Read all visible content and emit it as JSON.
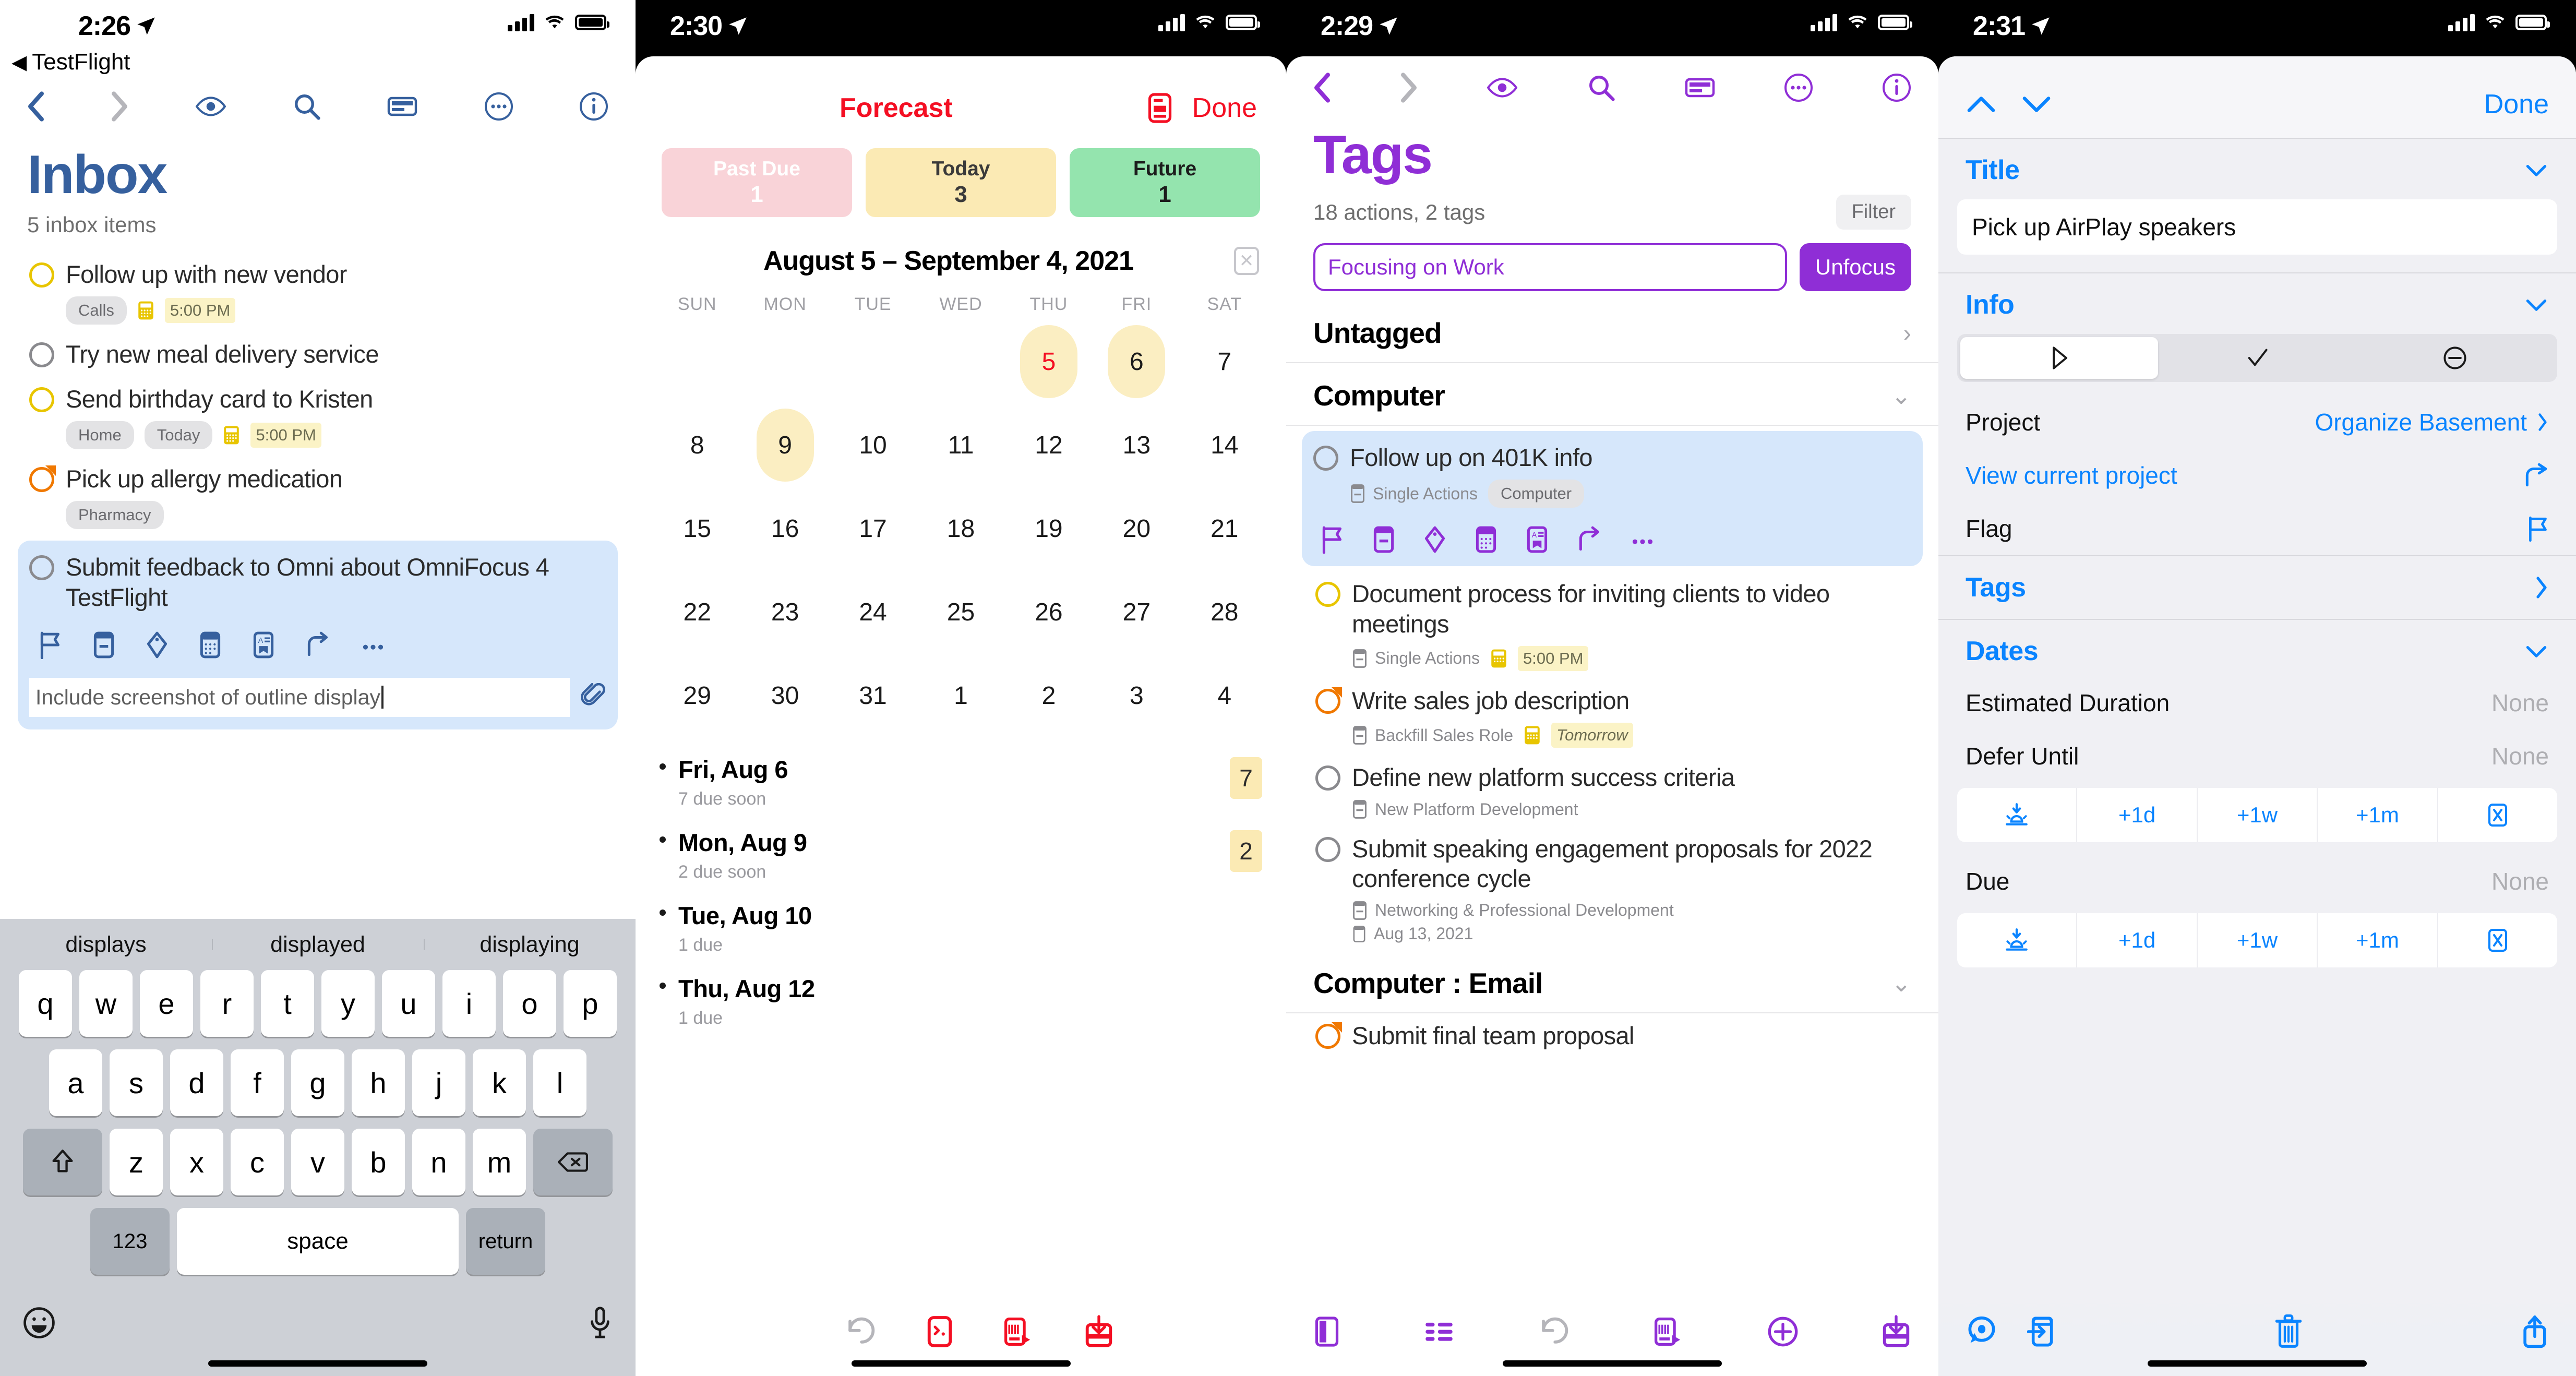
{
  "colors": {
    "inbox_blue": "#36609e",
    "forecast_red": "#f40f23",
    "tags_purple": "#8f2ed6",
    "inspector_blue": "#0a84ff",
    "selection_blue": "#d6e7fb",
    "flag_orange": "#f07800",
    "due_yellow": "#e8c500"
  },
  "panel1": {
    "status": {
      "time": "2:26",
      "back_app": "TestFlight"
    },
    "nav": {
      "back": "chevron-left",
      "forward": "chevron-right",
      "items": [
        "eye-icon",
        "search-icon",
        "layout-icon",
        "more-icon",
        "info-icon"
      ]
    },
    "title": "Inbox",
    "subtitle": "5 inbox items",
    "tasks": [
      {
        "title": "Follow up with new vendor",
        "circle": "yellow",
        "tags": [
          "Calls"
        ],
        "due": "5:00 PM",
        "due_style": "normal"
      },
      {
        "title": "Try new meal delivery service",
        "circle": "gray",
        "tags": [],
        "due": "",
        "due_style": "none"
      },
      {
        "title": "Send birthday card to Kristen",
        "circle": "yellow",
        "tags": [
          "Home",
          "Today"
        ],
        "due": "5:00 PM",
        "due_style": "normal"
      },
      {
        "title": "Pick up allergy medication",
        "circle": "orange",
        "tags": [
          "Pharmacy"
        ],
        "due": "",
        "due_style": "none"
      }
    ],
    "selected_task": {
      "title": "Submit feedback to Omni about OmniFocus 4 TestFlight",
      "circle": "gray",
      "tools": [
        "flag-icon",
        "project-icon",
        "tag-icon",
        "calendar-icon",
        "note-icon",
        "move-icon",
        "more-icon"
      ],
      "note_value": "Include screenshot of outline display",
      "attachment_icon": "paperclip-icon"
    },
    "keyboard": {
      "suggestions": [
        "displays",
        "displayed",
        "displaying"
      ],
      "row1": [
        "q",
        "w",
        "e",
        "r",
        "t",
        "y",
        "u",
        "i",
        "o",
        "p"
      ],
      "row2": [
        "a",
        "s",
        "d",
        "f",
        "g",
        "h",
        "j",
        "k",
        "l"
      ],
      "row3": [
        "z",
        "x",
        "c",
        "v",
        "b",
        "n",
        "m"
      ],
      "shift": "shift-icon",
      "backspace": "backspace-icon",
      "numbers": "123",
      "space": "space",
      "return": "return",
      "emoji": "emoji-icon",
      "mic": "microphone-icon"
    }
  },
  "panel2": {
    "status": {
      "time": "2:30"
    },
    "header": {
      "title": "Forecast",
      "done": "Done",
      "layout_icon": "layout-icon"
    },
    "buckets": [
      {
        "label": "Past Due",
        "count": "1",
        "color": "#f9d3d8"
      },
      {
        "label": "Today",
        "count": "3",
        "color": "#fbeab4"
      },
      {
        "label": "Future",
        "count": "1",
        "color": "#94e4ae"
      }
    ],
    "calendar": {
      "range": "August 5 – September 4, 2021",
      "close_icon": "close-icon",
      "weekdays": [
        "SUN",
        "MON",
        "TUE",
        "WED",
        "THU",
        "FRI",
        "SAT"
      ],
      "cells": [
        {
          "d": "",
          "hl": false,
          "today": false
        },
        {
          "d": "",
          "hl": false,
          "today": false
        },
        {
          "d": "",
          "hl": false,
          "today": false
        },
        {
          "d": "",
          "hl": false,
          "today": false
        },
        {
          "d": "5",
          "hl": true,
          "today": true
        },
        {
          "d": "6",
          "hl": true,
          "today": false
        },
        {
          "d": "7",
          "hl": false,
          "today": false
        },
        {
          "d": "8",
          "hl": false,
          "today": false
        },
        {
          "d": "9",
          "hl": true,
          "today": false
        },
        {
          "d": "10",
          "hl": false,
          "today": false
        },
        {
          "d": "11",
          "hl": false,
          "today": false
        },
        {
          "d": "12",
          "hl": false,
          "today": false
        },
        {
          "d": "13",
          "hl": false,
          "today": false
        },
        {
          "d": "14",
          "hl": false,
          "today": false
        },
        {
          "d": "15",
          "hl": false,
          "today": false
        },
        {
          "d": "16",
          "hl": false,
          "today": false
        },
        {
          "d": "17",
          "hl": false,
          "today": false
        },
        {
          "d": "18",
          "hl": false,
          "today": false
        },
        {
          "d": "19",
          "hl": false,
          "today": false
        },
        {
          "d": "20",
          "hl": false,
          "today": false
        },
        {
          "d": "21",
          "hl": false,
          "today": false
        },
        {
          "d": "22",
          "hl": false,
          "today": false
        },
        {
          "d": "23",
          "hl": false,
          "today": false
        },
        {
          "d": "24",
          "hl": false,
          "today": false
        },
        {
          "d": "25",
          "hl": false,
          "today": false
        },
        {
          "d": "26",
          "hl": false,
          "today": false
        },
        {
          "d": "27",
          "hl": false,
          "today": false
        },
        {
          "d": "28",
          "hl": false,
          "today": false
        },
        {
          "d": "29",
          "hl": false,
          "today": false
        },
        {
          "d": "30",
          "hl": false,
          "today": false
        },
        {
          "d": "31",
          "hl": false,
          "today": false
        },
        {
          "d": "1",
          "hl": false,
          "today": false
        },
        {
          "d": "2",
          "hl": false,
          "today": false
        },
        {
          "d": "3",
          "hl": false,
          "today": false
        },
        {
          "d": "4",
          "hl": false,
          "today": false
        }
      ]
    },
    "days": [
      {
        "name": "Fri, Aug 6",
        "sub": "7 due soon",
        "badge": "7"
      },
      {
        "name": "Mon, Aug 9",
        "sub": "2 due soon",
        "badge": "2"
      },
      {
        "name": "Tue, Aug 10",
        "sub": "1 due",
        "badge": ""
      },
      {
        "name": "Thu, Aug 12",
        "sub": "1 due",
        "badge": ""
      }
    ],
    "bottom_icons": [
      "undo-icon",
      "quick-entry-icon",
      "new-action-icon",
      "inbox-icon"
    ]
  },
  "panel3": {
    "status": {
      "time": "2:29"
    },
    "nav": {
      "items": [
        "eye-icon",
        "search-icon",
        "layout-icon",
        "more-icon",
        "info-icon"
      ]
    },
    "title": "Tags",
    "subtitle": "18 actions, 2 tags",
    "filter_label": "Filter",
    "focus_value": "Focusing on Work",
    "unfocus_label": "Unfocus",
    "groups": [
      {
        "name": "Untagged",
        "chevron": "chevron-right"
      },
      {
        "name": "Computer",
        "chevron": "chevron-down"
      }
    ],
    "selected_task": {
      "title": "Follow up on 401K info",
      "project": "Single Actions",
      "tag": "Computer",
      "tools": [
        "flag-icon",
        "project-icon",
        "tag-icon",
        "calendar-icon",
        "note-icon",
        "move-icon",
        "more-icon"
      ]
    },
    "tasks": [
      {
        "title": "Document process for inviting clients to video meetings",
        "circle": "yellow",
        "project": "Single Actions",
        "due": "5:00 PM",
        "due_style": "normal",
        "extra": ""
      },
      {
        "title": "Write sales job description",
        "circle": "orange",
        "project": "Backfill Sales Role",
        "due": "Tomorrow",
        "due_style": "italic",
        "extra": ""
      },
      {
        "title": "Define new platform success criteria",
        "circle": "gray",
        "project": "New Platform Development",
        "due": "",
        "due_style": "none",
        "extra": ""
      },
      {
        "title": "Submit speaking engagement proposals for 2022 conference cycle",
        "circle": "gray",
        "project": "Networking & Professional Development",
        "due": "",
        "due_style": "none",
        "extra": "Aug 13, 2021"
      }
    ],
    "group2": {
      "name": "Computer : Email",
      "chevron": "chevron-down"
    },
    "group2_task": {
      "title": "Submit final team proposal",
      "circle": "orange"
    },
    "bottom_icons": [
      "sidebar-icon",
      "outline-icon",
      "undo-icon",
      "new-action-icon",
      "add-icon",
      "inbox-icon"
    ]
  },
  "panel4": {
    "status": {
      "time": "2:31"
    },
    "nav": {
      "up": "chevron-up",
      "down": "chevron-down",
      "done": "Done"
    },
    "sections": {
      "title": {
        "header": "Title",
        "chevron": "chevron-down",
        "value": "Pick up AirPlay speakers"
      },
      "info": {
        "header": "Info",
        "chevron": "chevron-down",
        "status_segments": [
          "active-icon",
          "completed-icon",
          "dropped-icon"
        ],
        "status_selected": 0,
        "rows": [
          {
            "label": "Project",
            "value": "Organize Basement",
            "accessory": "chevron-right"
          },
          {
            "label": "View current project",
            "value": "",
            "accessory": "move-icon",
            "link": true
          },
          {
            "label": "Flag",
            "value": "",
            "accessory": "flag-icon"
          }
        ]
      },
      "tags": {
        "header": "Tags",
        "chevron": "chevron-right"
      },
      "dates": {
        "header": "Dates",
        "chevron": "chevron-down",
        "estimated_duration_label": "Estimated Duration",
        "estimated_duration_value": "None",
        "defer_label": "Defer Until",
        "defer_value": "None",
        "due_label": "Due",
        "due_value": "None",
        "steppers": [
          "today-icon",
          "+1d",
          "+1w",
          "+1m",
          "clear-icon"
        ]
      }
    },
    "bottom_icons": [
      "focus-icon",
      "move-icon",
      "delete-icon",
      "share-icon"
    ]
  }
}
